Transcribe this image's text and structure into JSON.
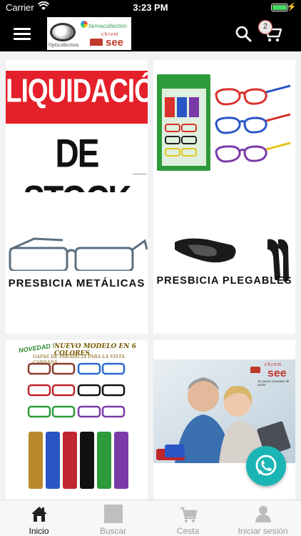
{
  "status_bar": {
    "carrier": "Carrier",
    "time": "3:23 PM"
  },
  "header": {
    "menu_icon": "hamburger-icon",
    "logo": {
      "left_text": "Opticollection",
      "brand1": "farmacollection",
      "brand2_small": "chrom",
      "brand2": "see"
    },
    "search_icon": "search-icon",
    "cart_icon": "cart-icon",
    "cart_count": "2"
  },
  "tiles": [
    {
      "line1": "LIQUIDACIÓN",
      "line2": "DE STOCK"
    },
    {
      "caption": ""
    },
    {
      "caption": "PRESBICIA METÁLICAS"
    },
    {
      "caption": "PRESBICIA PLEGABLES"
    },
    {
      "badge": "NOVEDAD !",
      "headline": "NUEVO MODELO EN 6 COLORES",
      "subline": "GAFAS DE PRESBICIA PARA LA VISTA CANSADA"
    },
    {
      "small": "chrom",
      "brand": "see",
      "tagline": "Tu nuevo concepto de visión"
    }
  ],
  "whatsapp_icon": "whatsapp-icon",
  "tab_bar": [
    {
      "label": "Inicio",
      "icon": "home-icon",
      "active": true
    },
    {
      "label": "Buscar",
      "icon": "search-tab-icon",
      "active": false
    },
    {
      "label": "Cesta",
      "icon": "basket-icon",
      "active": false
    },
    {
      "label": "Iniciar sesión",
      "icon": "user-icon",
      "active": false
    }
  ],
  "colors": {
    "header_bg": "#000000",
    "sale_red": "#e4202a",
    "whatsapp": "#1cb5b5"
  }
}
